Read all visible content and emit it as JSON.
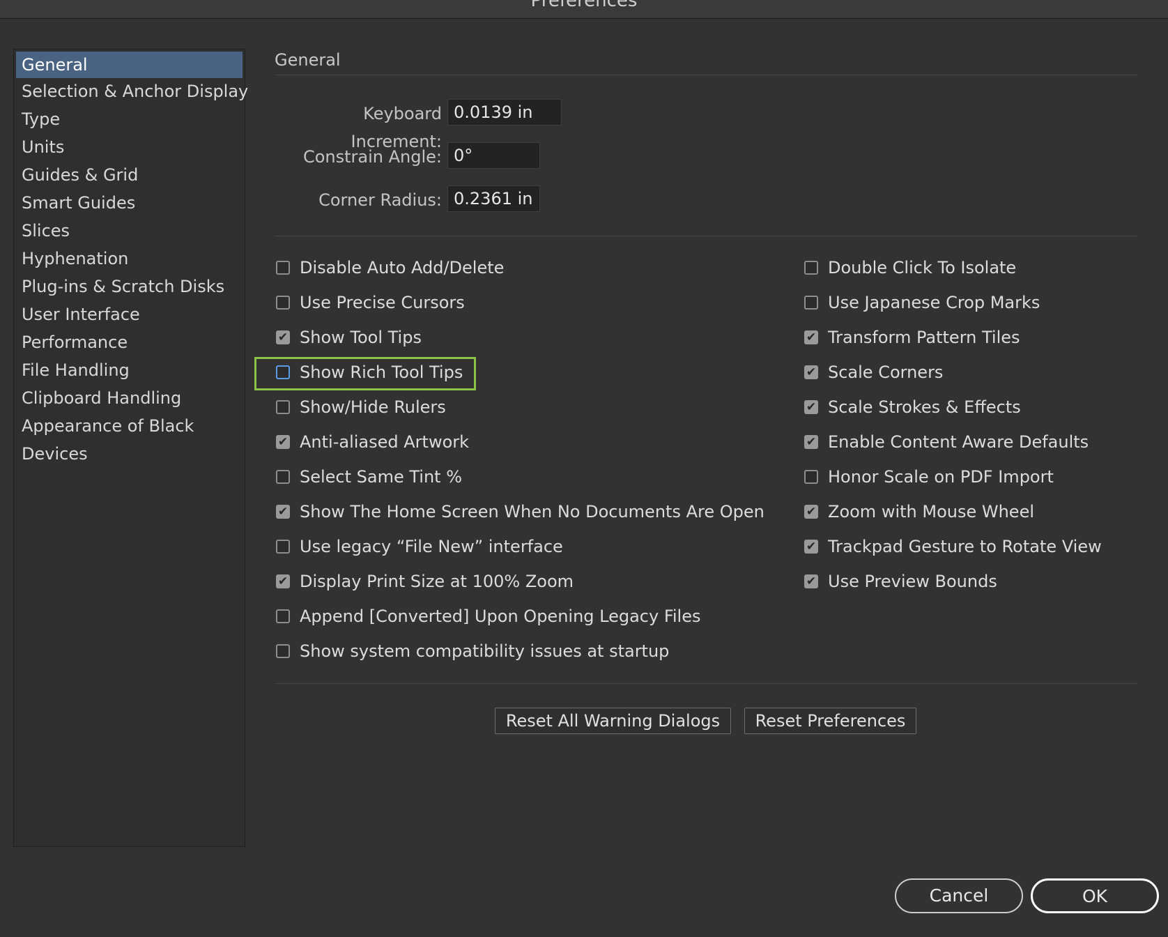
{
  "window": {
    "title": "Preferences"
  },
  "sidebar": {
    "items": [
      {
        "label": "General",
        "selected": true
      },
      {
        "label": "Selection & Anchor Display"
      },
      {
        "label": "Type"
      },
      {
        "label": "Units"
      },
      {
        "label": "Guides & Grid"
      },
      {
        "label": "Smart Guides"
      },
      {
        "label": "Slices"
      },
      {
        "label": "Hyphenation"
      },
      {
        "label": "Plug-ins & Scratch Disks"
      },
      {
        "label": "User Interface"
      },
      {
        "label": "Performance"
      },
      {
        "label": "File Handling"
      },
      {
        "label": "Clipboard Handling"
      },
      {
        "label": "Appearance of Black"
      },
      {
        "label": "Devices"
      }
    ]
  },
  "general": {
    "title": "General",
    "fields": {
      "keyboard_increment": {
        "label": "Keyboard Increment:",
        "value": "0.0139 in"
      },
      "constrain_angle": {
        "label": "Constrain Angle:",
        "value": "0°"
      },
      "corner_radius": {
        "label": "Corner Radius:",
        "value": "0.2361 in"
      }
    },
    "left_options": [
      {
        "label": "Disable Auto Add/Delete",
        "checked": false
      },
      {
        "label": "Use Precise Cursors",
        "checked": false
      },
      {
        "label": "Show Tool Tips",
        "checked": true
      },
      {
        "label": "Show Rich Tool Tips",
        "checked": false,
        "focused": true
      },
      {
        "label": "Show/Hide Rulers",
        "checked": false
      },
      {
        "label": "Anti-aliased Artwork",
        "checked": true
      },
      {
        "label": "Select Same Tint %",
        "checked": false
      },
      {
        "label": "Show The Home Screen When No Documents Are Open",
        "checked": true
      },
      {
        "label": "Use legacy “File New” interface",
        "checked": false
      },
      {
        "label": "Display Print Size at 100% Zoom",
        "checked": true
      },
      {
        "label": "Append [Converted] Upon Opening Legacy Files",
        "checked": false
      },
      {
        "label": "Show system compatibility issues at startup",
        "checked": false
      }
    ],
    "right_options": [
      {
        "label": "Double Click To Isolate",
        "checked": false
      },
      {
        "label": "Use Japanese Crop Marks",
        "checked": false
      },
      {
        "label": "Transform Pattern Tiles",
        "checked": true
      },
      {
        "label": "Scale Corners",
        "checked": true
      },
      {
        "label": "Scale Strokes & Effects",
        "checked": true
      },
      {
        "label": "Enable Content Aware Defaults",
        "checked": true
      },
      {
        "label": "Honor Scale on PDF Import",
        "checked": false
      },
      {
        "label": "Zoom with Mouse Wheel",
        "checked": true
      },
      {
        "label": "Trackpad Gesture to Rotate View",
        "checked": true
      },
      {
        "label": "Use Preview Bounds",
        "checked": true
      }
    ],
    "buttons": {
      "reset_warnings": "Reset All Warning Dialogs",
      "reset_preferences": "Reset Preferences"
    }
  },
  "footer": {
    "cancel": "Cancel",
    "ok": "OK"
  },
  "colors": {
    "selection": "#4b6382",
    "highlight": "#8bc34a",
    "background": "#323232"
  }
}
